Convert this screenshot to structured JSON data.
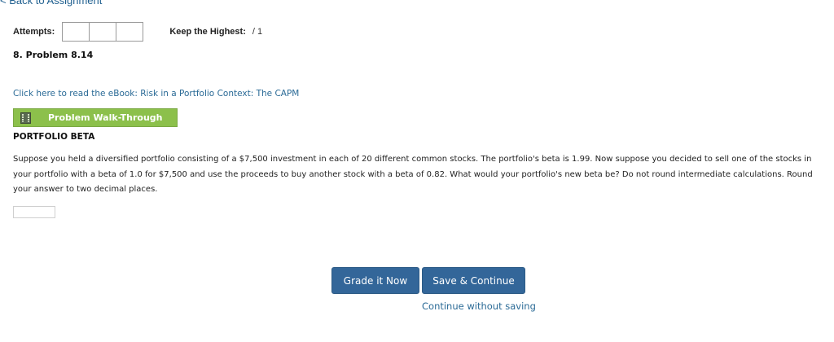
{
  "nav": {
    "back_label": "< Back to Assignment"
  },
  "attempts": {
    "label": "Attempts:",
    "keep_label": "Keep the Highest:",
    "keep_value": "/ 1"
  },
  "problem": {
    "title": "8.  Problem 8.14",
    "ebook_link": "Click here to read the eBook: Risk in a Portfolio Context: The CAPM",
    "walkthrough_label": "Problem Walk-Through",
    "heading": "PORTFOLIO BETA",
    "text": "Suppose you held a diversified portfolio consisting of a $7,500 investment in each of 20 different common stocks. The portfolio's beta is 1.99. Now suppose you decided to sell one of the stocks in your portfolio with a beta of 1.0 for $7,500 and use the proceeds to buy another stock with a beta of 0.82. What would your portfolio's new beta be? Do not round intermediate calculations. Round your answer to two decimal places.",
    "answer_value": ""
  },
  "actions": {
    "grade_label": "Grade it Now",
    "save_label": "Save & Continue",
    "continue_label": "Continue without saving"
  },
  "colors": {
    "primary_button": "#336699",
    "walkthrough_button": "#8cc04b",
    "link": "#2a6a96"
  },
  "icons": {
    "walkthrough": "film-icon"
  }
}
